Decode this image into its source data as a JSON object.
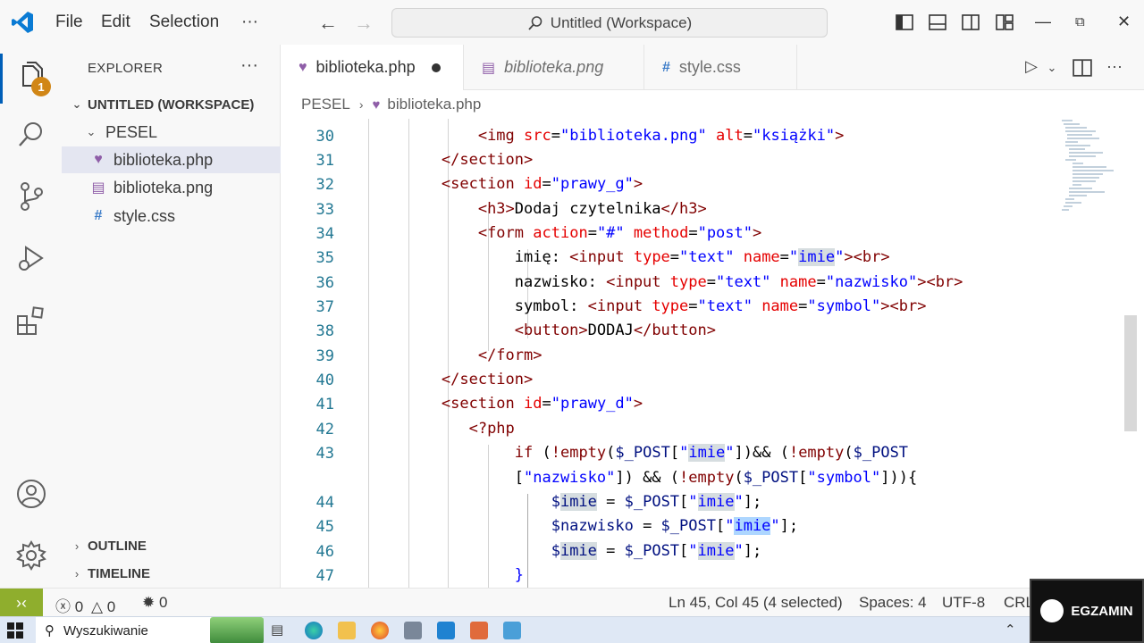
{
  "window": {
    "menus": [
      "File",
      "Edit",
      "Selection",
      "···"
    ],
    "command_center": "Untitled (Workspace)",
    "accent": "#005fb8"
  },
  "activity_bar": {
    "explorer_badge": "1",
    "icons": [
      "files-icon",
      "search-icon",
      "source-control-icon",
      "run-debug-icon",
      "extensions-icon",
      "account-icon",
      "settings-gear-icon"
    ]
  },
  "sidebar": {
    "title": "EXPLORER",
    "more": "···",
    "workspace": "UNTITLED (WORKSPACE)",
    "folder": "PESEL",
    "files": [
      {
        "name": "biblioteka.php",
        "icon": "php-icon",
        "selected": true
      },
      {
        "name": "biblioteka.png",
        "icon": "image-icon",
        "selected": false
      },
      {
        "name": "style.css",
        "icon": "css-icon",
        "selected": false
      }
    ],
    "outline": "OUTLINE",
    "timeline": "TIMELINE"
  },
  "tabs": [
    {
      "label": "biblioteka.php",
      "dirty": true,
      "active": true
    },
    {
      "label": "biblioteka.png",
      "dirty": false,
      "active": false
    },
    {
      "label": "style.css",
      "dirty": false,
      "active": false
    }
  ],
  "breadcrumb": {
    "folder": "PESEL",
    "file": "biblioteka.php"
  },
  "editor": {
    "line_numbers": [
      "30",
      "31",
      "32",
      "33",
      "34",
      "35",
      "36",
      "37",
      "38",
      "39",
      "40",
      "41",
      "42",
      "43",
      "",
      "44",
      "45",
      "46",
      "47"
    ]
  },
  "status_bar": {
    "errors": "0",
    "warnings": "0",
    "ports": "0",
    "cursor": "Ln 45, Col 45 (4 selected)",
    "spaces": "Spaces: 4",
    "encoding": "UTF-8",
    "eol": "CRL"
  },
  "taskbar": {
    "search_placeholder": "Wyszukiwanie"
  },
  "watermark": "EGZAMIN"
}
